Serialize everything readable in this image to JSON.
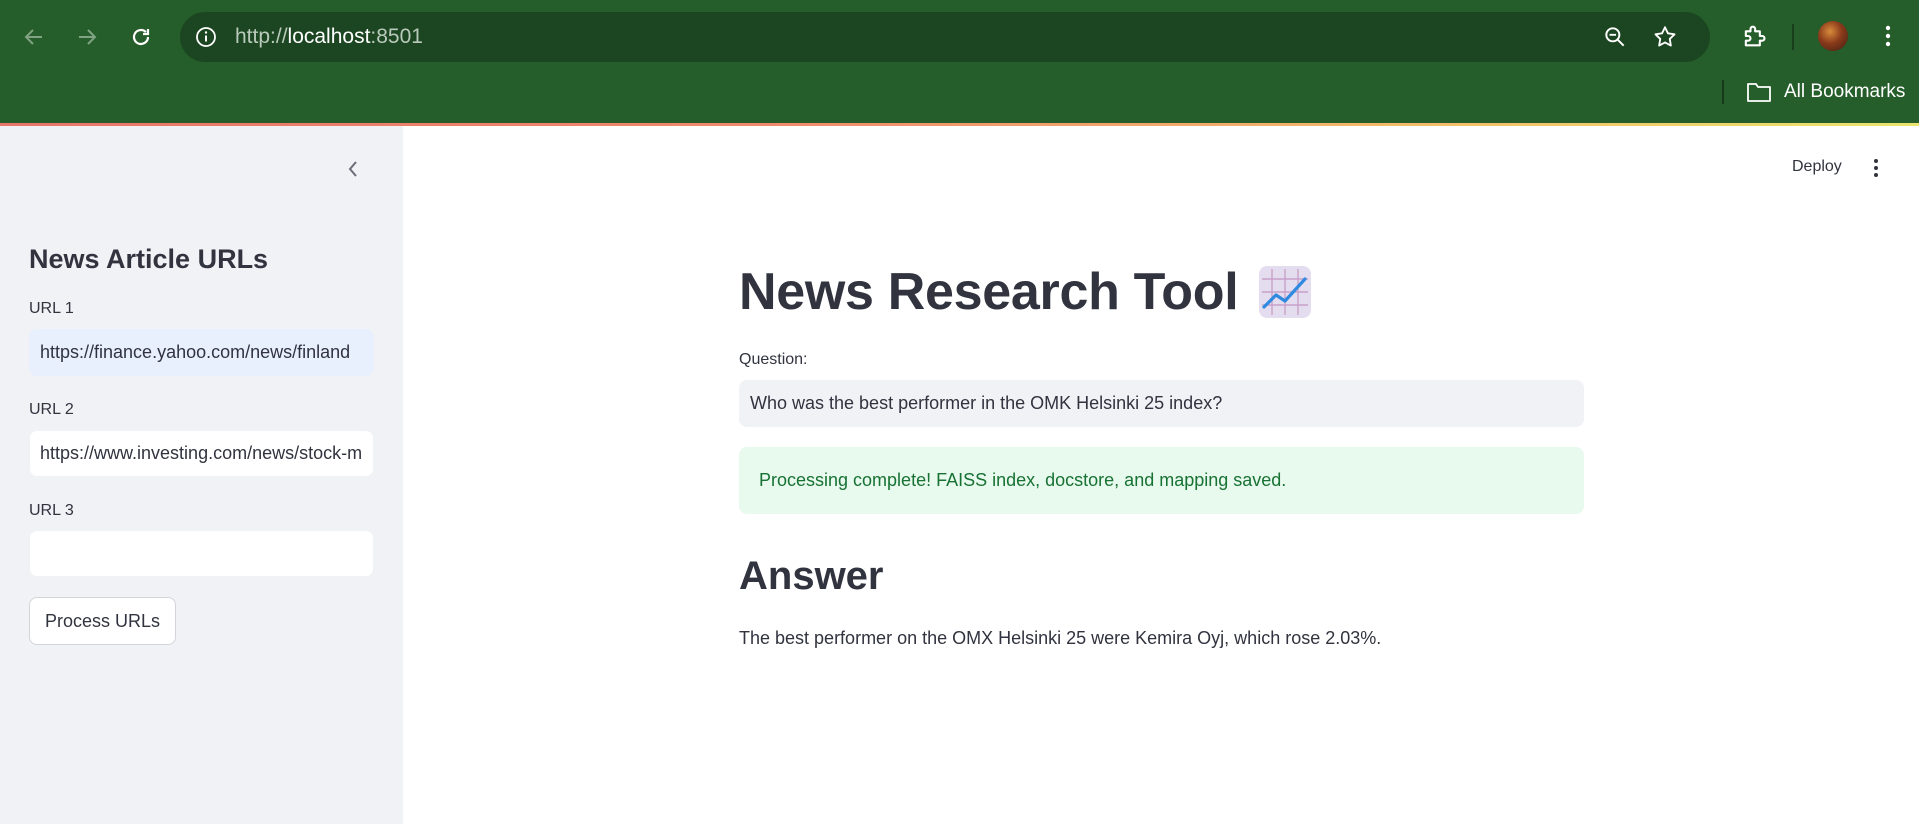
{
  "browser": {
    "url_scheme": "http://",
    "url_host": "localhost",
    "url_port": ":8501",
    "bookmarks_label": "All Bookmarks"
  },
  "sidebar": {
    "heading": "News Article URLs",
    "urls": [
      {
        "label": "URL 1",
        "value": "https://finance.yahoo.com/news/finland"
      },
      {
        "label": "URL 2",
        "value": "https://www.investing.com/news/stock-m"
      },
      {
        "label": "URL 3",
        "value": ""
      }
    ],
    "process_button": "Process URLs"
  },
  "header": {
    "deploy_label": "Deploy"
  },
  "main": {
    "title": "News Research Tool",
    "title_icon": "chart-increasing-icon",
    "question_label": "Question:",
    "question_value": "Who was the best performer in the OMK Helsinki 25 index?",
    "success_message": "Processing complete! FAISS index, docstore, and mapping saved.",
    "answer_heading": "Answer",
    "answer_text": "The best performer on the OMX Helsinki 25 were Kemira Oyj, which rose 2.03%."
  },
  "colors": {
    "chrome": "#255e2a",
    "omnibox": "#1c4621",
    "sidebar_bg": "#f0f2f6",
    "success_bg": "#e8f9ee",
    "success_text": "#177233",
    "text": "#31333f"
  }
}
